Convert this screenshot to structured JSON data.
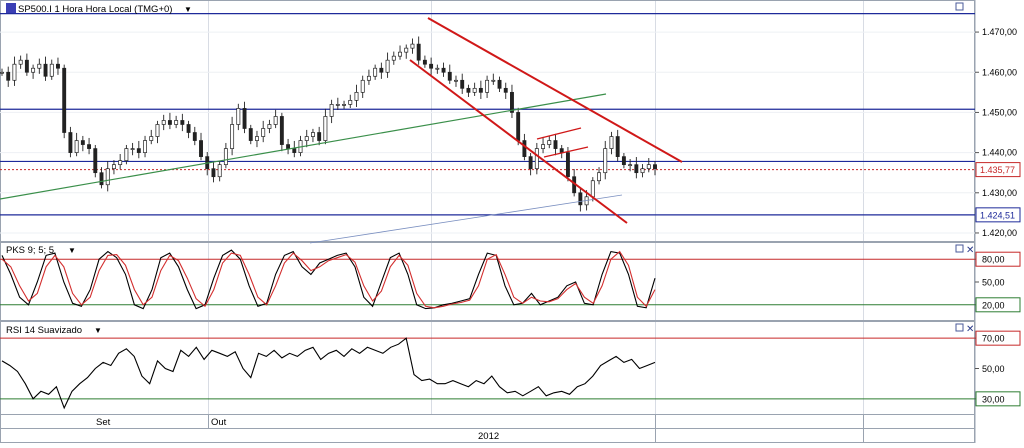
{
  "chart_data": [
    {
      "type": "candlestick",
      "title": "SP500.I 1 Hora Hora Local (TMG+0)",
      "yticks": [
        "1.470,00",
        "1.460,00",
        "1.450,00",
        "1.440,00",
        "1.430,00",
        "1.420,00"
      ],
      "ylim": [
        1418,
        1474
      ],
      "price_tags": [
        {
          "label": "1.435,77",
          "value": 1435.77,
          "color": "#c62828"
        },
        {
          "label": "1.424,51",
          "value": 1424.51,
          "color": "#1e2a9a"
        }
      ],
      "hlines": [
        {
          "value": 1474.6,
          "color": "#1e2a9a"
        },
        {
          "value": 1450.8,
          "color": "#1e2a9a"
        },
        {
          "value": 1437.8,
          "color": "#1e2a9a"
        },
        {
          "value": 1424.5,
          "color": "#1e2a9a"
        }
      ],
      "close_series": [
        1460,
        1458,
        1462,
        1463,
        1460,
        1461,
        1462,
        1459,
        1462,
        1461,
        1445,
        1440,
        1443,
        1442,
        1441,
        1435,
        1432,
        1436,
        1437,
        1438,
        1441,
        1441,
        1440,
        1443,
        1444,
        1447,
        1448,
        1447,
        1448,
        1447,
        1445,
        1443,
        1439,
        1436,
        1434,
        1437,
        1441,
        1447,
        1451,
        1446,
        1443,
        1444,
        1446,
        1447,
        1449,
        1442,
        1441,
        1440,
        1443,
        1444,
        1445,
        1443,
        1449,
        1452,
        1452,
        1452,
        1453,
        1455,
        1458,
        1459,
        1461,
        1460,
        1463,
        1464,
        1465,
        1466,
        1467,
        1463,
        1462,
        1461,
        1461,
        1460,
        1458,
        1458,
        1456,
        1455,
        1456,
        1455,
        1458,
        1458,
        1456,
        1455,
        1450,
        1443,
        1439,
        1436,
        1441,
        1442,
        1443,
        1441,
        1440,
        1434,
        1430,
        1427,
        1429,
        1433,
        1435,
        1441,
        1444,
        1439,
        1437,
        1437,
        1435,
        1436,
        1437,
        1436
      ]
    },
    {
      "type": "line",
      "title": "PKS 9; 5; 5",
      "yticks": [
        "80,00",
        "50,00",
        "20,00"
      ],
      "ylim": [
        0,
        100
      ],
      "levels": [
        80,
        20
      ],
      "series": [
        {
          "color": "#000000",
          "values": [
            85,
            60,
            30,
            20,
            50,
            85,
            88,
            50,
            22,
            18,
            40,
            80,
            90,
            82,
            60,
            20,
            15,
            40,
            82,
            88,
            70,
            40,
            15,
            20,
            55,
            85,
            92,
            80,
            45,
            18,
            22,
            60,
            85,
            90,
            70,
            60,
            75,
            80,
            85,
            88,
            70,
            30,
            18,
            50,
            82,
            88,
            60,
            20,
            15,
            16,
            20,
            22,
            25,
            28,
            60,
            88,
            85,
            45,
            20,
            22,
            35,
            20,
            25,
            30,
            45,
            50,
            22,
            20,
            60,
            90,
            88,
            60,
            18,
            16,
            55
          ]
        },
        {
          "color": "#d32f2f",
          "values": [
            80,
            70,
            45,
            25,
            35,
            70,
            85,
            70,
            35,
            20,
            30,
            65,
            85,
            86,
            72,
            40,
            20,
            30,
            65,
            85,
            78,
            55,
            28,
            18,
            40,
            75,
            88,
            85,
            60,
            30,
            20,
            45,
            75,
            88,
            78,
            65,
            70,
            78,
            82,
            86,
            76,
            45,
            25,
            38,
            70,
            85,
            72,
            35,
            18,
            16,
            18,
            21,
            23,
            26,
            45,
            80,
            86,
            60,
            30,
            22,
            30,
            25,
            24,
            28,
            40,
            48,
            30,
            22,
            45,
            80,
            90,
            72,
            30,
            18,
            40
          ]
        }
      ]
    },
    {
      "type": "line",
      "title": "RSI 14 Suavizado",
      "yticks": [
        "70,00",
        "50,00",
        "30,00"
      ],
      "ylim": [
        20,
        80
      ],
      "levels": [
        70,
        30
      ],
      "series": [
        {
          "color": "#000000",
          "values": [
            55,
            52,
            48,
            40,
            30,
            35,
            33,
            38,
            24,
            35,
            40,
            44,
            50,
            54,
            52,
            60,
            63,
            58,
            45,
            40,
            55,
            50,
            48,
            62,
            58,
            64,
            56,
            62,
            60,
            58,
            61,
            50,
            44,
            60,
            58,
            62,
            57,
            60,
            58,
            62,
            64,
            56,
            60,
            62,
            58,
            63,
            60,
            64,
            62,
            60,
            64,
            66,
            70,
            46,
            42,
            43,
            40,
            40,
            42,
            40,
            38,
            42,
            40,
            45,
            38,
            34,
            35,
            32,
            35,
            38,
            32,
            34,
            35,
            33,
            38,
            40,
            45,
            52,
            55,
            58,
            54,
            56,
            50,
            52,
            54
          ]
        }
      ]
    }
  ],
  "xaxis": {
    "month_labels": [
      "Set",
      "Out"
    ],
    "year_label": "2012"
  }
}
